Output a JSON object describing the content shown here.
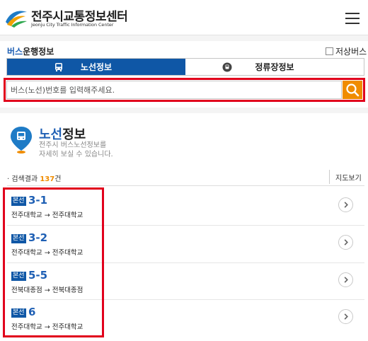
{
  "header": {
    "title": "전주시교통정보센터",
    "subtitle": "Jeonju City Traffic Information Center"
  },
  "bus_info": {
    "title_prefix": "버스",
    "title_suffix": "운행정보",
    "lowfloor_label": "저상버스",
    "lowfloor_checked": false,
    "tabs": [
      {
        "label": "노선정보",
        "active": true,
        "icon": "bus-icon"
      },
      {
        "label": "정류장정보",
        "active": false,
        "icon": "bus-stop-icon"
      }
    ],
    "search_placeholder": "버스(노선)번호를 입력해주세요.",
    "search_value": ""
  },
  "route_section": {
    "heading_prefix": "노선",
    "heading_suffix": "정보",
    "desc_line1": "전주시 버스노선정보를",
    "desc_line2": "자세히 보실 수 있습니다.",
    "result_prefix": "· 검색결과 ",
    "result_count": "137",
    "result_suffix": "건",
    "map_view": "지도보기"
  },
  "routes": [
    {
      "badge": "본선",
      "number": "3-1",
      "path": "전주대학교 → 전주대학교"
    },
    {
      "badge": "본선",
      "number": "3-2",
      "path": "전주대학교 → 전주대학교"
    },
    {
      "badge": "본선",
      "number": "5-5",
      "path": "전북대종점 → 전북대종점"
    },
    {
      "badge": "본선",
      "number": "6",
      "path": "전주대학교 → 전주대학교"
    }
  ],
  "colors": {
    "primary_blue": "#0f57a6",
    "accent_orange": "#f08c00",
    "highlight_red": "#e1001c"
  }
}
